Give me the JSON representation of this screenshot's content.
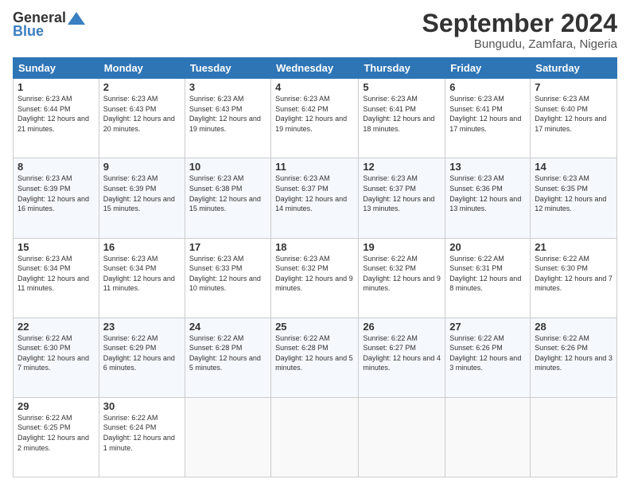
{
  "logo": {
    "general": "General",
    "blue": "Blue"
  },
  "title": "September 2024",
  "location": "Bungudu, Zamfara, Nigeria",
  "days_of_week": [
    "Sunday",
    "Monday",
    "Tuesday",
    "Wednesday",
    "Thursday",
    "Friday",
    "Saturday"
  ],
  "weeks": [
    [
      {
        "day": "1",
        "sunrise": "6:23 AM",
        "sunset": "6:44 PM",
        "daylight": "12 hours and 21 minutes."
      },
      {
        "day": "2",
        "sunrise": "6:23 AM",
        "sunset": "6:43 PM",
        "daylight": "12 hours and 20 minutes."
      },
      {
        "day": "3",
        "sunrise": "6:23 AM",
        "sunset": "6:43 PM",
        "daylight": "12 hours and 19 minutes."
      },
      {
        "day": "4",
        "sunrise": "6:23 AM",
        "sunset": "6:42 PM",
        "daylight": "12 hours and 19 minutes."
      },
      {
        "day": "5",
        "sunrise": "6:23 AM",
        "sunset": "6:41 PM",
        "daylight": "12 hours and 18 minutes."
      },
      {
        "day": "6",
        "sunrise": "6:23 AM",
        "sunset": "6:41 PM",
        "daylight": "12 hours and 17 minutes."
      },
      {
        "day": "7",
        "sunrise": "6:23 AM",
        "sunset": "6:40 PM",
        "daylight": "12 hours and 17 minutes."
      }
    ],
    [
      {
        "day": "8",
        "sunrise": "6:23 AM",
        "sunset": "6:39 PM",
        "daylight": "12 hours and 16 minutes."
      },
      {
        "day": "9",
        "sunrise": "6:23 AM",
        "sunset": "6:39 PM",
        "daylight": "12 hours and 15 minutes."
      },
      {
        "day": "10",
        "sunrise": "6:23 AM",
        "sunset": "6:38 PM",
        "daylight": "12 hours and 15 minutes."
      },
      {
        "day": "11",
        "sunrise": "6:23 AM",
        "sunset": "6:37 PM",
        "daylight": "12 hours and 14 minutes."
      },
      {
        "day": "12",
        "sunrise": "6:23 AM",
        "sunset": "6:37 PM",
        "daylight": "12 hours and 13 minutes."
      },
      {
        "day": "13",
        "sunrise": "6:23 AM",
        "sunset": "6:36 PM",
        "daylight": "12 hours and 13 minutes."
      },
      {
        "day": "14",
        "sunrise": "6:23 AM",
        "sunset": "6:35 PM",
        "daylight": "12 hours and 12 minutes."
      }
    ],
    [
      {
        "day": "15",
        "sunrise": "6:23 AM",
        "sunset": "6:34 PM",
        "daylight": "12 hours and 11 minutes."
      },
      {
        "day": "16",
        "sunrise": "6:23 AM",
        "sunset": "6:34 PM",
        "daylight": "12 hours and 11 minutes."
      },
      {
        "day": "17",
        "sunrise": "6:23 AM",
        "sunset": "6:33 PM",
        "daylight": "12 hours and 10 minutes."
      },
      {
        "day": "18",
        "sunrise": "6:23 AM",
        "sunset": "6:32 PM",
        "daylight": "12 hours and 9 minutes."
      },
      {
        "day": "19",
        "sunrise": "6:22 AM",
        "sunset": "6:32 PM",
        "daylight": "12 hours and 9 minutes."
      },
      {
        "day": "20",
        "sunrise": "6:22 AM",
        "sunset": "6:31 PM",
        "daylight": "12 hours and 8 minutes."
      },
      {
        "day": "21",
        "sunrise": "6:22 AM",
        "sunset": "6:30 PM",
        "daylight": "12 hours and 7 minutes."
      }
    ],
    [
      {
        "day": "22",
        "sunrise": "6:22 AM",
        "sunset": "6:30 PM",
        "daylight": "12 hours and 7 minutes."
      },
      {
        "day": "23",
        "sunrise": "6:22 AM",
        "sunset": "6:29 PM",
        "daylight": "12 hours and 6 minutes."
      },
      {
        "day": "24",
        "sunrise": "6:22 AM",
        "sunset": "6:28 PM",
        "daylight": "12 hours and 5 minutes."
      },
      {
        "day": "25",
        "sunrise": "6:22 AM",
        "sunset": "6:28 PM",
        "daylight": "12 hours and 5 minutes."
      },
      {
        "day": "26",
        "sunrise": "6:22 AM",
        "sunset": "6:27 PM",
        "daylight": "12 hours and 4 minutes."
      },
      {
        "day": "27",
        "sunrise": "6:22 AM",
        "sunset": "6:26 PM",
        "daylight": "12 hours and 3 minutes."
      },
      {
        "day": "28",
        "sunrise": "6:22 AM",
        "sunset": "6:26 PM",
        "daylight": "12 hours and 3 minutes."
      }
    ],
    [
      {
        "day": "29",
        "sunrise": "6:22 AM",
        "sunset": "6:25 PM",
        "daylight": "12 hours and 2 minutes."
      },
      {
        "day": "30",
        "sunrise": "6:22 AM",
        "sunset": "6:24 PM",
        "daylight": "12 hours and 1 minute."
      },
      null,
      null,
      null,
      null,
      null
    ]
  ]
}
